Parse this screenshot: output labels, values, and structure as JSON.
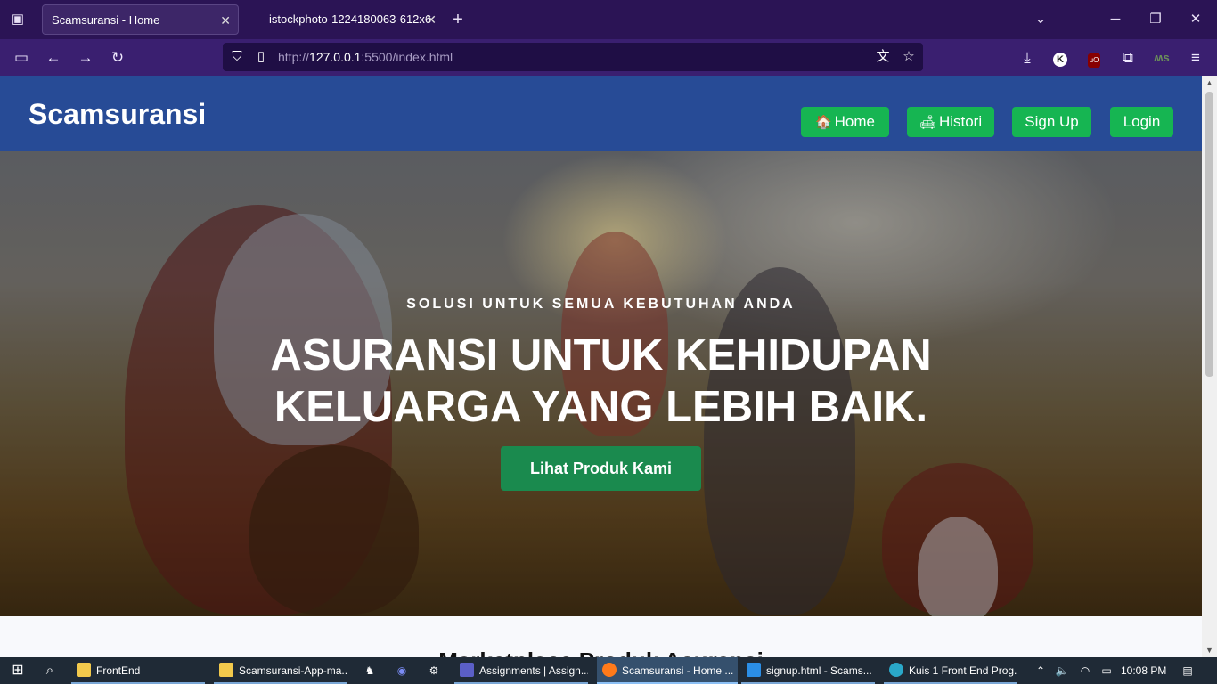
{
  "browser": {
    "tabs": [
      {
        "title": "Scamsuransi - Home",
        "active": true
      },
      {
        "title": "istockphoto-1224180063-612x6",
        "active": false
      }
    ],
    "url_prefix": "http://",
    "url_host": "127.0.0.1",
    "url_rest": ":5500/index.html"
  },
  "site": {
    "brand": "Scamsuransi",
    "nav": [
      {
        "label": "Home",
        "icon": "house-icon"
      },
      {
        "label": "Histori",
        "icon": "sofa-icon"
      },
      {
        "label": "Sign Up",
        "icon": ""
      },
      {
        "label": "Login",
        "icon": ""
      }
    ],
    "hero": {
      "subtitle": "SOLUSI UNTUK SEMUA KEBUTUHAN ANDA",
      "title_line1": "ASURANSI UNTUK KEHIDUPAN",
      "title_line2": "KELUARGA YANG LEBIH BAIK.",
      "button": "Lihat Produk Kami"
    },
    "section_title": "Marketplace Produk Asuransi"
  },
  "taskbar": {
    "items": [
      "FrontEnd",
      "Scamsuransi-App-ma...",
      "Assignments | Assign...",
      "Scamsuransi - Home ...",
      "signup.html - Scams...",
      "Kuis 1 Front End Prog..."
    ],
    "clock": "10:08 PM"
  },
  "colors": {
    "header": "#274b96",
    "nav_button": "#16b552",
    "hero_button": "#1a8a4e"
  }
}
